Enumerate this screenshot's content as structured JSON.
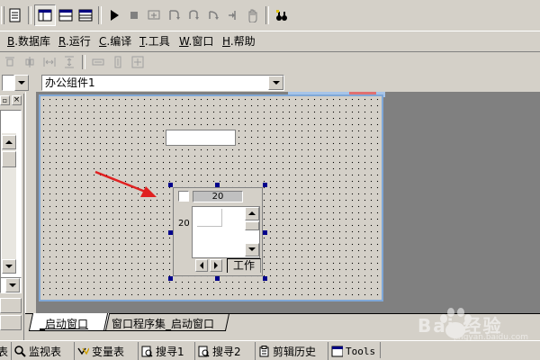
{
  "menu": {
    "items": [
      {
        "key": "B",
        "rest": ".数据库"
      },
      {
        "key": "R",
        "rest": ".运行"
      },
      {
        "key": "C",
        "rest": ".编译"
      },
      {
        "key": "T",
        "rest": ".工具"
      },
      {
        "key": "W",
        "rest": ".窗口"
      },
      {
        "key": "H",
        "rest": ".帮助"
      }
    ]
  },
  "component_select": {
    "value": "办公组件1"
  },
  "design_widget": {
    "spin_value": "20",
    "side_value": "20",
    "tab_label": "工作"
  },
  "editor_tabs": [
    {
      "label": "_启动窗口",
      "active": true
    },
    {
      "label": "窗口程序集_启动窗口",
      "active": false
    }
  ],
  "bottom_tabs": [
    {
      "label": "监视表",
      "icon": "magnifier-icon"
    },
    {
      "label": "变量表",
      "icon": "variable-icon"
    },
    {
      "label": "搜寻1",
      "icon": "find-icon"
    },
    {
      "label": "搜寻2",
      "icon": "find-icon"
    },
    {
      "label": "剪辑历史",
      "icon": "clipboard-icon"
    },
    {
      "label": "Tools",
      "icon": "window-icon"
    }
  ],
  "watermark": {
    "text": "Bai 经验",
    "url": "jingyan.baidu.com"
  },
  "colors": {
    "face": "#d4d0c8",
    "dark_area": "#808080",
    "handle": "#00008b",
    "arrow": "#e02020",
    "window_border": "#7fa8d8"
  }
}
